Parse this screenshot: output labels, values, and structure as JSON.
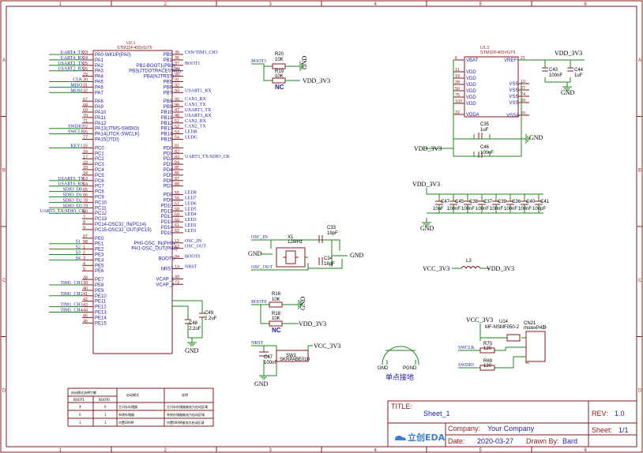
{
  "zones": {
    "cols": [
      "1",
      "2",
      "3",
      "4",
      "5",
      "6"
    ],
    "rows": [
      "A",
      "B",
      "C",
      "D"
    ]
  },
  "u2": {
    "ref": "U2.1",
    "part": "STM32F405VGT6",
    "left": [
      {
        "n": "23",
        "l": "PA0-WKUP(PA0)",
        "net": "UART4_TX"
      },
      {
        "n": "24",
        "l": "PA1",
        "net": "UART4_RX"
      },
      {
        "n": "25",
        "l": "PA2",
        "net": "USART2_TX"
      },
      {
        "n": "26",
        "l": "PA3",
        "net": "USART2_RX"
      },
      {
        "n": "29",
        "l": "PA4",
        "net": ""
      },
      {
        "n": "30",
        "l": "PA5",
        "net": "CLK"
      },
      {
        "n": "31",
        "l": "PA6",
        "net": "MISO"
      },
      {
        "n": "32",
        "l": "PA7",
        "net": "MOSI"
      },
      {
        "n": "67",
        "l": "PA8",
        "net": ""
      },
      {
        "n": "68",
        "l": "PA9",
        "net": ""
      },
      {
        "n": "69",
        "l": "PA10",
        "net": ""
      },
      {
        "n": "70",
        "l": "PA11",
        "net": ""
      },
      {
        "n": "71",
        "l": "PA12",
        "net": ""
      },
      {
        "n": "72",
        "l": "PA13(JTMS-SWDIO)",
        "net": "SWDIO"
      },
      {
        "n": "76",
        "l": "PA14(JTCK-SWCLK)",
        "net": "SWCLK"
      },
      {
        "n": "77",
        "l": "PA15(JTDI)",
        "net": ""
      },
      {
        "n": "15",
        "l": "PC0",
        "net": "KEY1"
      },
      {
        "n": "16",
        "l": "PC1",
        "net": ""
      },
      {
        "n": "17",
        "l": "PC2",
        "net": ""
      },
      {
        "n": "18",
        "l": "PC3",
        "net": ""
      },
      {
        "n": "33",
        "l": "PC4",
        "net": ""
      },
      {
        "n": "34",
        "l": "PC5",
        "net": ""
      },
      {
        "n": "63",
        "l": "PC6",
        "net": "USART6_TX"
      },
      {
        "n": "64",
        "l": "PC7",
        "net": "USART6_RX"
      },
      {
        "n": "65",
        "l": "PC8",
        "net": "SDIO_D0"
      },
      {
        "n": "66",
        "l": "PC9",
        "net": "SDIO_D1"
      },
      {
        "n": "78",
        "l": "PC10",
        "net": "SDIO_D2"
      },
      {
        "n": "79",
        "l": "PC11",
        "net": "SDIO_D3"
      },
      {
        "n": "80",
        "l": "PC12",
        "net": "UART5_TX/SDIO_CK"
      },
      {
        "n": "7",
        "l": "PC13",
        "net": ""
      },
      {
        "n": "8",
        "l": "PC14-OSC32_IN(PC14)",
        "net": ""
      },
      {
        "n": "9",
        "l": "PC15-OSC32_OUT(PC15)",
        "net": ""
      },
      {
        "n": "97",
        "l": "PE0",
        "net": ""
      },
      {
        "n": "98",
        "l": "PE1",
        "net": "S1"
      },
      {
        "n": "1",
        "l": "PE2",
        "net": "S2"
      },
      {
        "n": "2",
        "l": "PE3",
        "net": "S3"
      },
      {
        "n": "3",
        "l": "PE4",
        "net": "S4"
      },
      {
        "n": "4",
        "l": "PE5",
        "net": ""
      },
      {
        "n": "5",
        "l": "PE6",
        "net": ""
      },
      {
        "n": "38",
        "l": "PE7",
        "net": ""
      },
      {
        "n": "39",
        "l": "PE8",
        "net": "TIM1_CH1"
      },
      {
        "n": "40",
        "l": "PE9",
        "net": ""
      },
      {
        "n": "41",
        "l": "PE10",
        "net": "TIM1_CH2"
      },
      {
        "n": "42",
        "l": "PE11",
        "net": ""
      },
      {
        "n": "43",
        "l": "PE12",
        "net": "TIM1_CH3"
      },
      {
        "n": "44",
        "l": "PE13",
        "net": "TIM1_CH4"
      },
      {
        "n": "45",
        "l": "PE14",
        "net": ""
      },
      {
        "n": "46",
        "l": "PE15",
        "net": ""
      }
    ],
    "right": [
      {
        "n": "35",
        "l": "PB0",
        "net": "CSN/TIM3_CH3"
      },
      {
        "n": "36",
        "l": "PB1",
        "net": ""
      },
      {
        "n": "37",
        "l": "PB2-BOOT1(PB2)",
        "net": "BOOT1"
      },
      {
        "n": "89",
        "l": "PB3(JTDOTRACESWO)",
        "net": ""
      },
      {
        "n": "90",
        "l": "PB4(NJTRST)",
        "net": ""
      },
      {
        "n": "91",
        "l": "PB5",
        "net": ""
      },
      {
        "n": "92",
        "l": "PB6",
        "net": ""
      },
      {
        "n": "93",
        "l": "PB7",
        "net": "USART1_RX"
      },
      {
        "n": "95",
        "l": "PB8",
        "net": "CAN1_RX"
      },
      {
        "n": "96",
        "l": "PB9",
        "net": "CAN1_TX"
      },
      {
        "n": "47",
        "l": "PB10",
        "net": "USART3_TX"
      },
      {
        "n": "48",
        "l": "PB11",
        "net": "USART3_RX"
      },
      {
        "n": "51",
        "l": "PB12",
        "net": "CAN2_RX"
      },
      {
        "n": "52",
        "l": "PB13",
        "net": "CAN2_TX"
      },
      {
        "n": "53",
        "l": "PB14",
        "net": "LEDR"
      },
      {
        "n": "54",
        "l": "PB15",
        "net": "LEDG"
      },
      {
        "n": "81",
        "l": "PD0",
        "net": ""
      },
      {
        "n": "82",
        "l": "PD1",
        "net": ""
      },
      {
        "n": "83",
        "l": "PD2",
        "net": "UART5_TX/SDIO_CK"
      },
      {
        "n": "84",
        "l": "PD3",
        "net": ""
      },
      {
        "n": "85",
        "l": "PD4",
        "net": ""
      },
      {
        "n": "86",
        "l": "PD5",
        "net": ""
      },
      {
        "n": "87",
        "l": "PD6",
        "net": ""
      },
      {
        "n": "88",
        "l": "PD7",
        "net": ""
      },
      {
        "n": "55",
        "l": "PD8",
        "net": "LED8"
      },
      {
        "n": "56",
        "l": "PD9",
        "net": "LED7"
      },
      {
        "n": "57",
        "l": "PD10",
        "net": "LED6"
      },
      {
        "n": "58",
        "l": "PD11",
        "net": "LED5"
      },
      {
        "n": "59",
        "l": "PD12",
        "net": "LED4"
      },
      {
        "n": "60",
        "l": "PD13",
        "net": "LED3"
      },
      {
        "n": "61",
        "l": "PD14",
        "net": "LED2"
      },
      {
        "n": "62",
        "l": "PD15",
        "net": "LED1"
      },
      {
        "n": "12",
        "l": "PH0-OSC_IN(PH0)",
        "net": "OSC_IN"
      },
      {
        "n": "13",
        "l": "PH1-OSC_OUT(PH1)",
        "net": "OSC_OUT"
      },
      {
        "n": "94",
        "l": "BOOT0",
        "net": "BOOT0"
      },
      {
        "n": "14",
        "l": "NRST",
        "net": "NRST"
      },
      {
        "n": "49",
        "l": "VCAP_1",
        "net": ""
      },
      {
        "n": "73",
        "l": "VCAP_2",
        "net": ""
      }
    ]
  },
  "u1": {
    "ref": "U1.2",
    "part": "STM32F405VGT6",
    "left": [
      {
        "n": "6",
        "l": "VBAT"
      },
      {
        "n": "11",
        "l": "VDD"
      },
      {
        "n": "19",
        "l": "VDD"
      },
      {
        "n": "28",
        "l": "VDD"
      },
      {
        "n": "50",
        "l": "VDD"
      },
      {
        "n": "75",
        "l": "VDD"
      },
      {
        "n": "100",
        "l": "VDD"
      },
      {
        "n": "22",
        "l": "VDDA"
      }
    ],
    "right": [
      {
        "n": "21",
        "l": "VREF+"
      },
      {
        "n": "10",
        "l": "VSS"
      },
      {
        "n": "27",
        "l": "VSS"
      },
      {
        "n": "74",
        "l": "VSS"
      },
      {
        "n": "99",
        "l": "VSS"
      },
      {
        "n": "20",
        "l": "VSSA"
      }
    ]
  },
  "power": {
    "vdd": "VDD_3V3",
    "vcc": "VCC_3V3",
    "gnd": "GND"
  },
  "boot1": {
    "net": "BOOT1",
    "r_top": "R20",
    "r_top_val": "10K",
    "r_bot": "R19",
    "r_bot_val": "10K",
    "nc": "NC"
  },
  "boot0": {
    "net": "BOOT0",
    "r_top": "R16",
    "r_top_val": "10K",
    "r_bot": "R18",
    "r_bot_val": "10K",
    "nc": "NC"
  },
  "osc": {
    "in": "OSC_IN",
    "out": "OSC_OUT",
    "x": "X1",
    "freq": "12MHz",
    "c1": "C33",
    "c1v": "18pF",
    "c2": "C34",
    "c2v": "18pF"
  },
  "vcap": {
    "c49": "C49",
    "c49v": "2.2uF",
    "c48": "C48",
    "c48v": "2.2uF"
  },
  "ref_caps": {
    "c43": "C43",
    "c43v": "100nF",
    "c44": "C44",
    "c44v": "1uF"
  },
  "vdda_caps": {
    "c35": "C35",
    "c35v": "1uF",
    "c46": "C46",
    "c46v": "100nF"
  },
  "decoup": {
    "caps": [
      {
        "r": "C47",
        "v": "10uF"
      },
      {
        "r": "C45",
        "v": "100nF"
      },
      {
        "r": "C38",
        "v": "100nF"
      },
      {
        "r": "C37",
        "v": "100nF"
      },
      {
        "r": "C39",
        "v": "100nF"
      },
      {
        "r": "C36",
        "v": "100nF"
      },
      {
        "r": "C40",
        "v": "100nF"
      },
      {
        "r": "C41",
        "v": "100pF"
      }
    ]
  },
  "inductor": {
    "ref": "L3",
    "in": "VCC_3V3",
    "out": "VDD_3V3"
  },
  "reset": {
    "net": "NRST",
    "sw": "SW1",
    "sw_part": "SKRPABE010",
    "c": "C47",
    "cv": "100nF"
  },
  "swd": {
    "u": "U14",
    "upart": "MF-NSMF050-2",
    "cn": "CN21",
    "cnpart": "molexP4卧",
    "r1": "R70",
    "r1v": "120",
    "r2": "R69",
    "r2v": "120",
    "swclk": "SWCLK",
    "swdio": "SWDIO"
  },
  "ground_tie": {
    "label": "单点接地",
    "a": "GND",
    "b": "PGND"
  },
  "boot_table": {
    "headers": [
      "启动模式选择引脚",
      "启动模式",
      "说明"
    ],
    "sub": [
      "BOOT1",
      "BOOT0"
    ],
    "rows": [
      [
        "X",
        "0",
        "主闪存存储器",
        "主闪存存储器被选为启动区域"
      ],
      [
        "0",
        "1",
        "系统存储器",
        "系统存储器被选为启动区域"
      ],
      [
        "1",
        "1",
        "内置SRAM",
        "内置SRAM被选为启动区域"
      ]
    ]
  },
  "title_block": {
    "title_label": "TITLE:",
    "title": "Sheet_1",
    "rev_label": "REV:",
    "rev": "1.0",
    "company_label": "Company:",
    "company": "Your Company",
    "sheet_label": "Sheet:",
    "sheet": "1/1",
    "date_label": "Date:",
    "date": "2020-03-27",
    "drawn_label": "Drawn By:",
    "drawn": "Bard",
    "logo": "立创EDA"
  }
}
